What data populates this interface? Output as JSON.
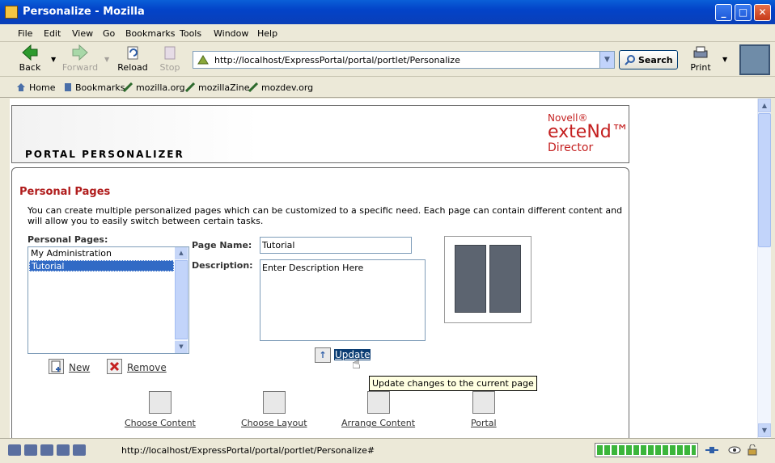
{
  "window": {
    "title": "Personalize - Mozilla"
  },
  "menu": [
    "File",
    "Edit",
    "View",
    "Go",
    "Bookmarks",
    "Tools",
    "Window",
    "Help"
  ],
  "nav": {
    "back": "Back",
    "forward": "Forward",
    "reload": "Reload",
    "stop": "Stop",
    "url": "http://localhost/ExpressPortal/portal/portlet/Personalize",
    "search": "Search",
    "print": "Print"
  },
  "bookmarks": [
    "Home",
    "Bookmarks",
    "mozilla.org",
    "mozillaZine",
    "mozdev.org"
  ],
  "portal": {
    "title": "PORTAL PERSONALIZER",
    "logo_line1": "Novell®",
    "logo_line2": "exteNd™",
    "logo_line3": "Director"
  },
  "personal_pages": {
    "heading": "Personal Pages",
    "description": "You can create multiple personalized pages which can be customized to a specific need. Each page can contain different content and will allow you to easily switch between certain tasks.",
    "list_label": "Personal Pages:",
    "pages": [
      "My Administration",
      "Tutorial"
    ],
    "selected_index": 1,
    "page_name_label": "Page Name:",
    "page_name_value": "Tutorial",
    "description_label": "Description:",
    "description_value": "Enter Description Here",
    "new_label": "New",
    "remove_label": "Remove",
    "update_label": "Update",
    "update_tooltip": "Update changes to the current page"
  },
  "bottom_actions": [
    "Choose Content",
    "Choose Layout",
    "Arrange Content",
    "Portal"
  ],
  "status": {
    "text": "http://localhost/ExpressPortal/portal/portlet/Personalize#",
    "progress": 1.0
  },
  "colors": {
    "titlebar": "#0343c8",
    "section_title": "#b01c1c",
    "logo": "#c41f1f",
    "selection": "#316ac5"
  }
}
